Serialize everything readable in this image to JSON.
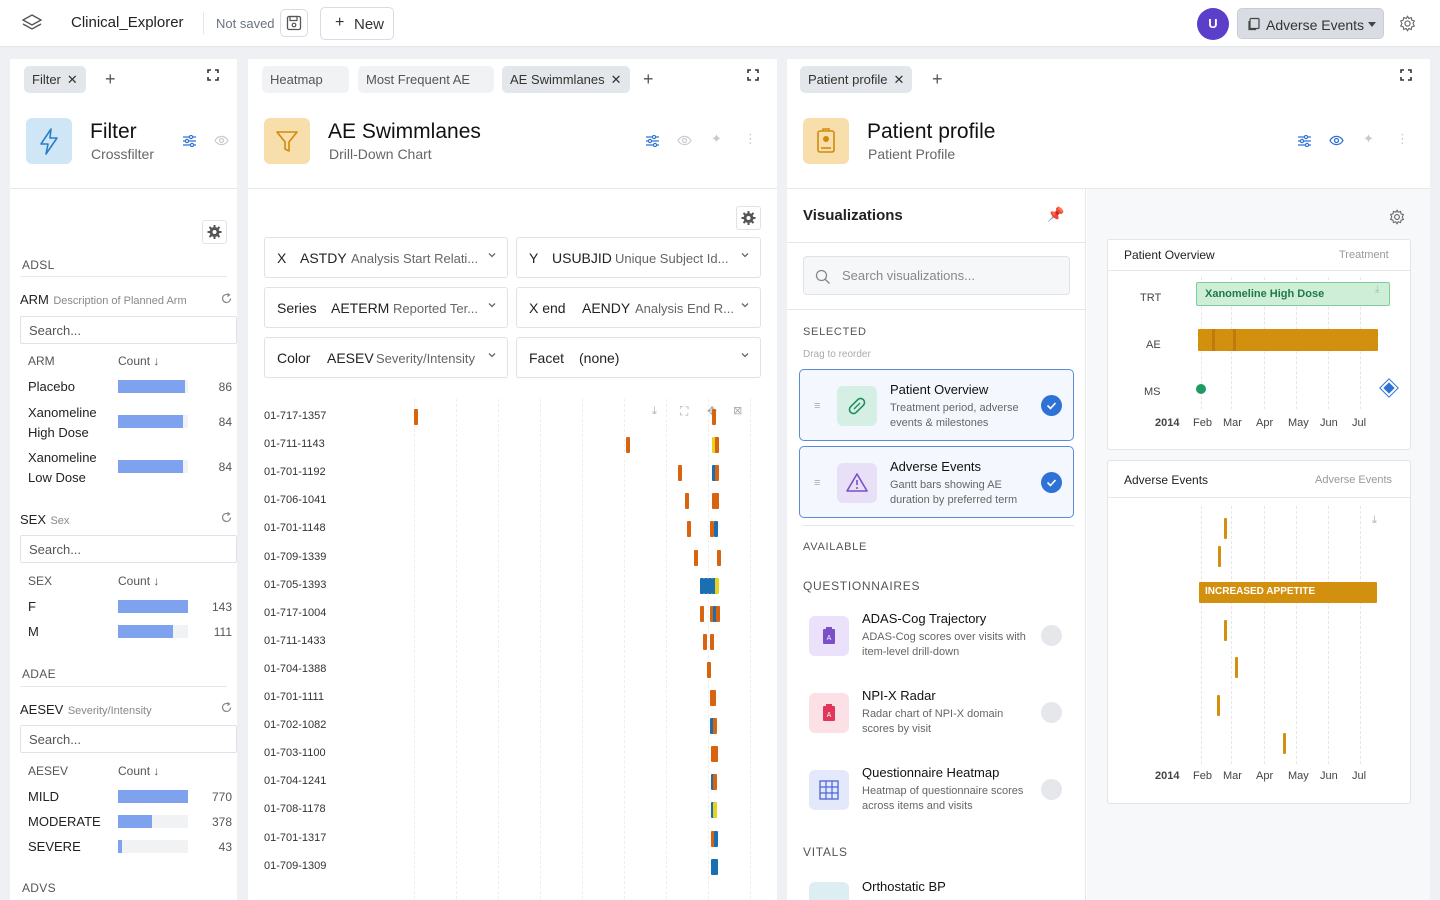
{
  "app": {
    "title": "Clinical_Explorer",
    "status": "Not saved",
    "new_label": "New",
    "user_initial": "U",
    "view_selected": "Adverse Events"
  },
  "filter_panel": {
    "tab": "Filter",
    "title": "Filter",
    "subtitle": "Crossfilter",
    "sections": [
      {
        "name": "ADSL"
      },
      {
        "name": "ADAE"
      },
      {
        "name": "ADVS"
      }
    ],
    "fields": [
      {
        "name": "ARM",
        "desc": "Description of Planned Arm",
        "search_placeholder": "Search...",
        "col1": "ARM",
        "col2": "Count",
        "rows": [
          {
            "label": "Placebo",
            "count": 86,
            "frac": 0.95
          },
          {
            "label": "Xanomeline High Dose",
            "count": 84,
            "frac": 0.93
          },
          {
            "label": "Xanomeline Low Dose",
            "count": 84,
            "frac": 0.93
          }
        ]
      },
      {
        "name": "SEX",
        "desc": "Sex",
        "search_placeholder": "Search...",
        "col1": "SEX",
        "col2": "Count",
        "rows": [
          {
            "label": "F",
            "count": 143,
            "frac": 1.0
          },
          {
            "label": "M",
            "count": 111,
            "frac": 0.78
          }
        ]
      },
      {
        "name": "AESEV",
        "desc": "Severity/Intensity",
        "search_placeholder": "Search...",
        "col1": "AESEV",
        "col2": "Count",
        "rows": [
          {
            "label": "MILD",
            "count": 770,
            "frac": 1.0
          },
          {
            "label": "MODERATE",
            "count": 378,
            "frac": 0.49
          },
          {
            "label": "SEVERE",
            "count": 43,
            "frac": 0.06
          }
        ]
      }
    ]
  },
  "swim_panel": {
    "tabs": [
      "Heatmap",
      "Most Frequent AE",
      "AE Swimmlanes"
    ],
    "title": "AE Swimmlanes",
    "subtitle": "Drill-Down Chart",
    "encodings": [
      {
        "key": "X",
        "value": "ASTDY",
        "desc": "Analysis Start Relati..."
      },
      {
        "key": "Y",
        "value": "USUBJID",
        "desc": "Unique Subject Id..."
      },
      {
        "key": "Series",
        "value": "AETERM",
        "desc": "Reported Ter..."
      },
      {
        "key": "X end",
        "value": "AENDY",
        "desc": "Analysis End R..."
      },
      {
        "key": "Color",
        "value": "AESEV",
        "desc": "Severity/Intensity"
      },
      {
        "key": "Facet",
        "value": "(none)",
        "desc": ""
      }
    ]
  },
  "chart_data": [
    {
      "type": "gantt",
      "title": "AE Swimmlanes",
      "categories": [
        "01-717-1357",
        "01-711-1143",
        "01-701-1192",
        "01-706-1041",
        "01-701-1148",
        "01-709-1339",
        "01-705-1393",
        "01-717-1004",
        "01-711-1433",
        "01-704-1388",
        "01-701-1111",
        "01-702-1082",
        "01-703-1100",
        "01-704-1241",
        "01-708-1178",
        "01-701-1317",
        "01-709-1309"
      ],
      "colors": {
        "MILD": "#d9640f",
        "MODERATE": "#1a6fb0",
        "SEVERE": "#e7d21e"
      }
    },
    {
      "type": "gantt",
      "title": "Patient Overview",
      "categories": [
        "TRT",
        "AE",
        "MS"
      ],
      "x_ticks": [
        "2014",
        "Feb",
        "Mar",
        "Apr",
        "May",
        "Jun",
        "Jul"
      ],
      "bar_label": "Xanomeline High Dose"
    },
    {
      "type": "gantt",
      "title": "Adverse Events",
      "x_ticks": [
        "2014",
        "Feb",
        "Mar",
        "Apr",
        "May",
        "Jun",
        "Jul"
      ],
      "bar_label": "INCREASED APPETITE"
    }
  ],
  "profile_panel": {
    "tab": "Patient profile",
    "title": "Patient profile",
    "subtitle": "Patient Profile",
    "viz_heading": "Visualizations",
    "search_placeholder": "Search visualizations...",
    "selected_label": "SELECTED",
    "drag_hint": "Drag to reorder",
    "selected": [
      {
        "title": "Patient Overview",
        "desc": "Treatment period, adverse events & milestones"
      },
      {
        "title": "Adverse Events",
        "desc": "Gantt bars showing AE duration by preferred term"
      }
    ],
    "available_label": "AVAILABLE",
    "questionnaires_label": "QUESTIONNAIRES",
    "available": [
      {
        "title": "ADAS-Cog Trajectory",
        "desc": "ADAS-Cog scores over visits with item-level drill-down"
      },
      {
        "title": "NPI-X Radar",
        "desc": "Radar chart of NPI-X domain scores by visit"
      },
      {
        "title": "Questionnaire Heatmap",
        "desc": "Heatmap of questionnaire scores across items and visits"
      }
    ],
    "vitals_label": "VITALS",
    "vitals_first": "Orthostatic BP",
    "overview_card": {
      "title": "Patient Overview",
      "tag": "Treatment"
    },
    "ae_card": {
      "title": "Adverse Events",
      "tag": "Adverse Events"
    }
  }
}
